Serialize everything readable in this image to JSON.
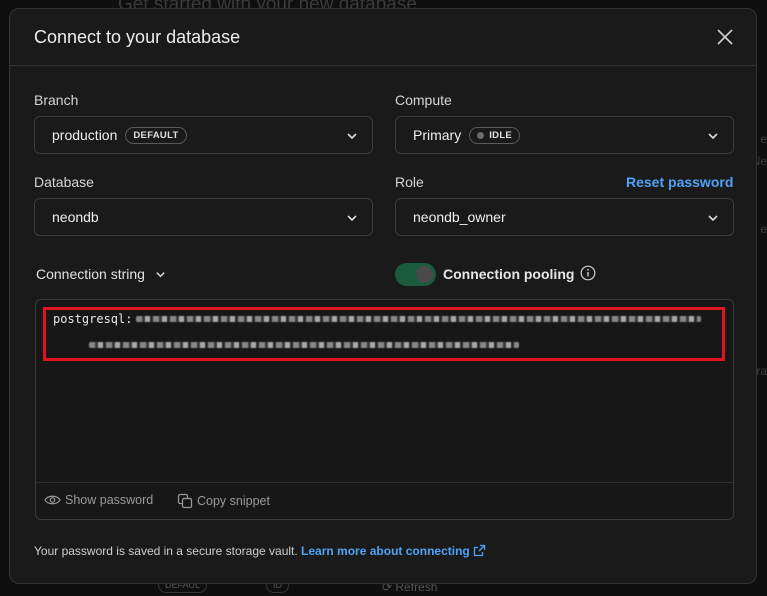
{
  "background": {
    "title": "Get started with your new database",
    "fragments": [
      "e",
      "Ne",
      "e",
      "ra"
    ],
    "bottom_badge": "DEFAUL",
    "bottom_id": "ID",
    "refresh_label": "Refresh"
  },
  "modal": {
    "title": "Connect to your database",
    "branch": {
      "label": "Branch",
      "value": "production",
      "badge": "DEFAULT"
    },
    "compute": {
      "label": "Compute",
      "value": "Primary",
      "badge": "IDLE"
    },
    "database": {
      "label": "Database",
      "value": "neondb"
    },
    "role": {
      "label": "Role",
      "value": "neondb_owner",
      "reset_link": "Reset password"
    },
    "connection_string_label": "Connection string",
    "pooling_label": "Connection pooling",
    "pooling_enabled": true,
    "code_prefix": "postgresql:",
    "show_password_label": "Show password",
    "copy_snippet_label": "Copy snippet",
    "note_text": "Your password is saved in a secure storage vault.",
    "learn_more_label": "Learn more about connecting"
  },
  "colors": {
    "accent": "#4fa3f7",
    "highlight": "#e0141e",
    "toggle_on": "#1a5a3d"
  }
}
